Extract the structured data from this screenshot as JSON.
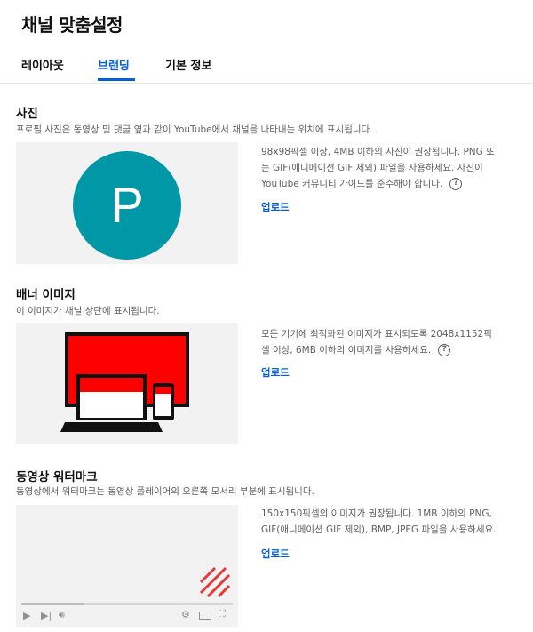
{
  "page": {
    "title": "채널 맞춤설정"
  },
  "tabs": [
    {
      "label": "레이아웃"
    },
    {
      "label": "브랜딩"
    },
    {
      "label": "기본 정보"
    }
  ],
  "photo": {
    "title": "사진",
    "description": "프로필 사진은 동영상 및 댓글 옆과 같이 YouTube에서 채널을 나타내는 위치에 표시됩니다.",
    "avatar_letter": "P",
    "avatar_color": "#0097a7",
    "info_lines": [
      "98x98픽셀 이상, 4MB 이하의 사진이 권장됩니다. PNG 또",
      "는 GIF(애니메이션 GIF 제외) 파일을 사용하세요. 사진이",
      "YouTube 커뮤니티 가이드를 준수해야 합니다."
    ],
    "help": "?",
    "upload_label": "업로드"
  },
  "banner": {
    "title": "배너 이미지",
    "description": "이 이미지가 채널 상단에 표시됩니다.",
    "info_lines": [
      "모든 기기에 최적화된 이미지가 표시되도록 2048x1152픽",
      "셀 이상, 6MB 이하의 이미지를 사용하세요."
    ],
    "help": "?",
    "upload_label": "업로드",
    "accent_color": "#ff0000"
  },
  "watermark": {
    "title": "동영상 워터마크",
    "description": "동영상에서 워터마크는 동영상 플레이어의 오른쪽 모서리 부분에 표시됩니다.",
    "info_lines": [
      "150x150픽셀의 이미지가 권장됩니다. 1MB 이하의 PNG,",
      "GIF(애니메이션 GIF 제외), BMP, JPEG 파일을 사용하세요."
    ],
    "upload_label": "업로드",
    "accent_color": "#e53935"
  },
  "colors": {
    "link": "#065fd4",
    "muted": "#606060",
    "preview_bg": "#f2f2f2"
  }
}
